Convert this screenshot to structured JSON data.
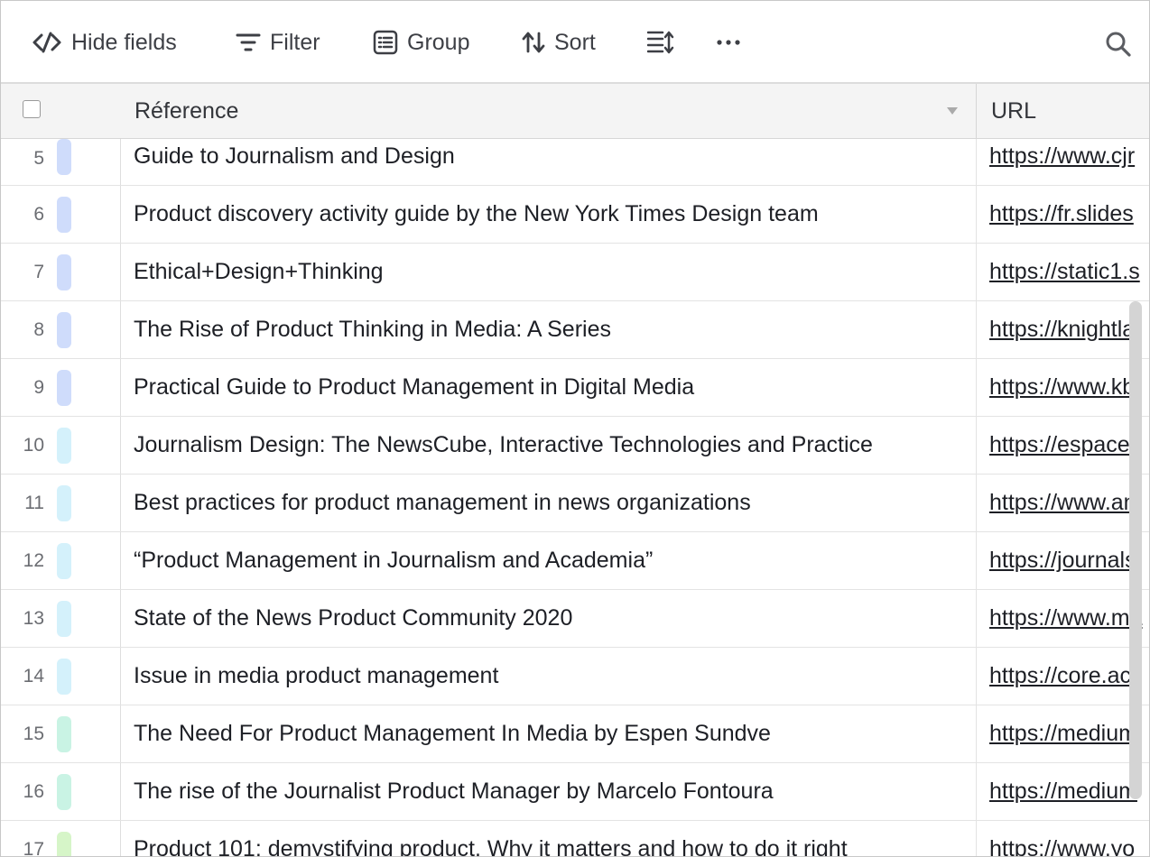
{
  "toolbar": {
    "hide_fields": "Hide fields",
    "filter": "Filter",
    "group": "Group",
    "sort": "Sort"
  },
  "header": {
    "reference": "Réference",
    "url": "URL"
  },
  "colors": {
    "blue": "#cfdcfb",
    "cyan": "#d4f1fb",
    "teal": "#c9f3e4",
    "green": "#d6f5c8"
  },
  "rows": [
    {
      "num": "5",
      "ref": "Guide to Journalism and Design",
      "url": "https://www.cjr",
      "color": "#cfdcfb"
    },
    {
      "num": "6",
      "ref": "Product discovery activity guide by the New York Times Design team",
      "url": "https://fr.slides",
      "color": "#cfdcfb"
    },
    {
      "num": "7",
      "ref": "Ethical+Design+Thinking",
      "url": "https://static1.s",
      "color": "#cfdcfb"
    },
    {
      "num": "8",
      "ref": "The Rise of Product Thinking in Media: A Series",
      "url": "https://knightla",
      "color": "#cfdcfb"
    },
    {
      "num": "9",
      "ref": "Practical Guide to Product Management in Digital Media",
      "url": "https://www.kb",
      "color": "#cfdcfb"
    },
    {
      "num": "10",
      "ref": "Journalism Design: The NewsCube, Interactive Technologies and Practice",
      "url": "https://espace.",
      "color": "#d4f1fb"
    },
    {
      "num": "11",
      "ref": "Best practices for product management in news organizations",
      "url": "https://www.an",
      "color": "#d4f1fb"
    },
    {
      "num": "12",
      "ref": "“Product Management in Journalism and Academia”",
      "url": "https://journals",
      "color": "#d4f1fb"
    },
    {
      "num": "13",
      "ref": "State of the News Product Community 2020",
      "url": "https://www.ma",
      "color": "#d4f1fb"
    },
    {
      "num": "14",
      "ref": "Issue in media product management",
      "url": "https://core.ac",
      "color": "#d4f1fb"
    },
    {
      "num": "15",
      "ref": "The Need For Product Management In Media by Espen Sundve",
      "url": "https://medium",
      "color": "#c9f3e4"
    },
    {
      "num": "16",
      "ref": "The rise of the Journalist Product Manager by Marcelo Fontoura",
      "url": "https://medium",
      "color": "#c9f3e4"
    },
    {
      "num": "17",
      "ref": "Product 101: demystifying product. Why it matters and how to do it right",
      "url": "https://www.yo",
      "color": "#d6f5c8"
    }
  ]
}
